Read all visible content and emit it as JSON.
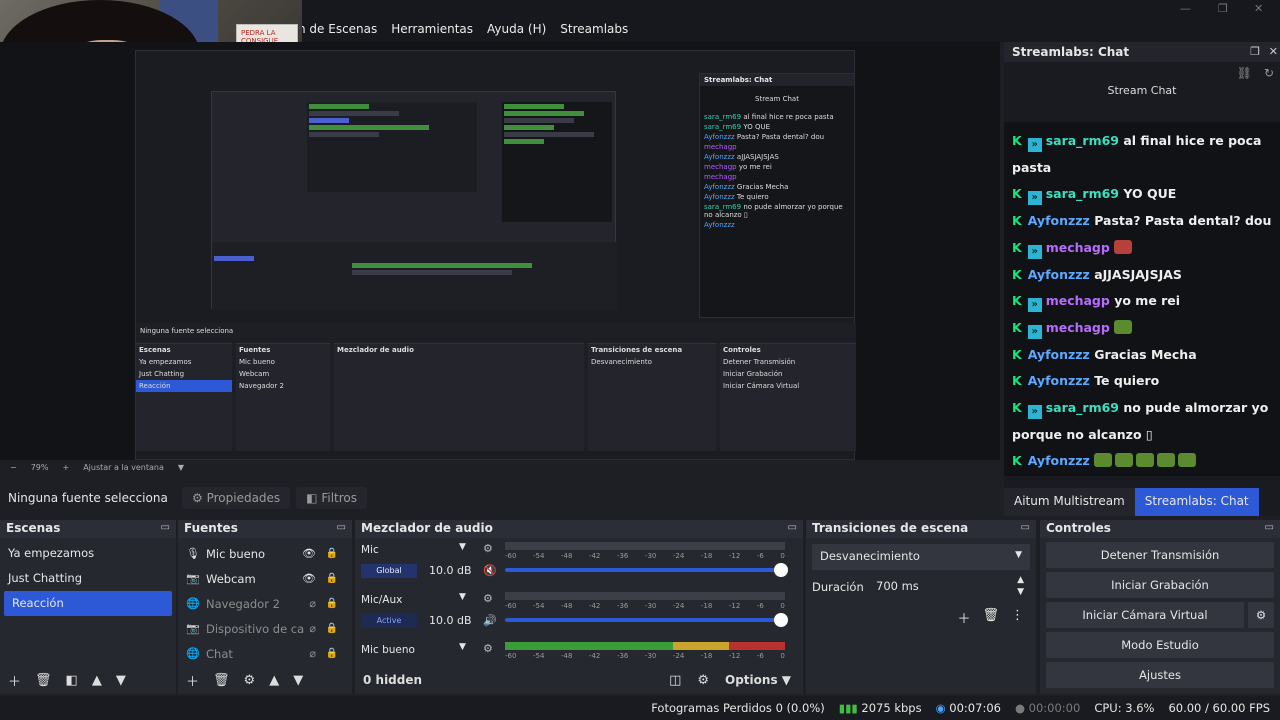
{
  "menu": {
    "items": [
      "n de Escenas",
      "Herramientas",
      "Ayuda (H)",
      "Streamlabs"
    ]
  },
  "webcam": {
    "paper_text": "PEDRA LA CONSIGUE..."
  },
  "preview": {
    "nested_chat_title": "Streamlabs: Chat",
    "nested_stream_chat": "Stream Chat",
    "nested_source_label": "Ninguna fuente selecciona",
    "nested_dock_titles": [
      "Escenas",
      "Fuentes",
      "Mezclador de audio",
      "Transiciones de escena",
      "Controles"
    ],
    "zoom": "79%",
    "zoom_label": "Ajustar a la ventana"
  },
  "chat": {
    "title": "Streamlabs: Chat",
    "stream_chat": "Stream Chat",
    "messages": [
      {
        "user": "sara_rm69",
        "text": "al final hice re poca pasta"
      },
      {
        "user": "sara_rm69",
        "text": "YO QUE"
      },
      {
        "user": "Ayfonzzz",
        "text": "Pasta? Pasta dental? dou"
      },
      {
        "user": "mechagp",
        "text": ""
      },
      {
        "user": "Ayfonzzz",
        "text": "aJJASJAJSJAS"
      },
      {
        "user": "mechagp",
        "text": "yo me rei"
      },
      {
        "user": "mechagp",
        "text": ""
      },
      {
        "user": "Ayfonzzz",
        "text": "Gracias Mecha"
      },
      {
        "user": "Ayfonzzz",
        "text": "Te quiero"
      },
      {
        "user": "sara_rm69",
        "text": "no pude almorzar yo porque no alcanzo ▯"
      },
      {
        "user": "Ayfonzzz",
        "text": ""
      }
    ],
    "tabs": [
      "Aitum Multistream",
      "Streamlabs: Chat"
    ]
  },
  "source_bar": {
    "label": "Ninguna fuente selecciona",
    "properties": "Propiedades",
    "filters": "Filtros"
  },
  "scenes": {
    "title": "Escenas",
    "items": [
      "Ya empezamos",
      "Just Chatting",
      "Reacción"
    ]
  },
  "sources": {
    "title": "Fuentes",
    "items": [
      {
        "name": "Mic bueno",
        "icon": "mic"
      },
      {
        "name": "Webcam",
        "icon": "camera"
      },
      {
        "name": "Navegador 2",
        "icon": "globe"
      },
      {
        "name": "Dispositivo de ca",
        "icon": "camera"
      },
      {
        "name": "Chat",
        "icon": "globe"
      }
    ]
  },
  "mixer": {
    "title": "Mezclador de audio",
    "channels": [
      {
        "name": "Mic",
        "tag": "Global",
        "db": "10.0 dB"
      },
      {
        "name": "Mic/Aux",
        "tag": "Active",
        "db": "10.0 dB"
      },
      {
        "name": "Mic bueno",
        "tag": "",
        "db": ""
      }
    ],
    "ticks": [
      "-60",
      "-54",
      "-48",
      "-42",
      "-36",
      "-30",
      "-24",
      "-18",
      "-12",
      "-6",
      "0"
    ],
    "hidden": "0 hidden",
    "options": "Options"
  },
  "transitions": {
    "title": "Transiciones de escena",
    "selected": "Desvanecimiento",
    "duration_label": "Duración",
    "duration_value": "700 ms"
  },
  "controls": {
    "title": "Controles",
    "buttons": [
      "Detener Transmisión",
      "Iniciar Grabación",
      "Iniciar Cámara Virtual",
      "Modo Estudio",
      "Ajustes"
    ]
  },
  "status": {
    "dropped": "Fotogramas Perdidos 0 (0.0%)",
    "bitrate": "2075 kbps",
    "stream_time": "00:07:06",
    "rec_time": "00:00:00",
    "cpu": "CPU: 3.6%",
    "fps": "60.00 / 60.00 FPS"
  },
  "colors": {
    "accent": "#2d59d6",
    "chat_username_green": "#19e47f"
  }
}
